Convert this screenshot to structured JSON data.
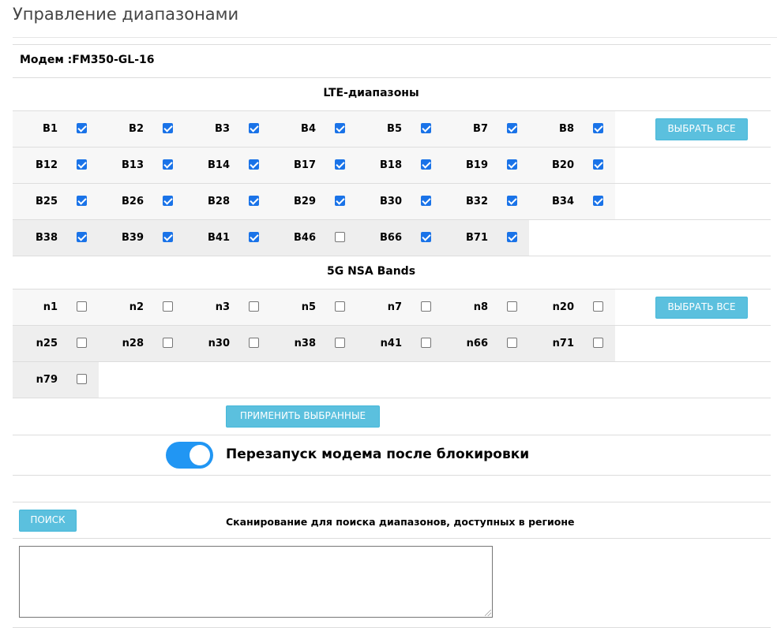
{
  "page": {
    "title": "Управление диапазонами"
  },
  "modem": {
    "label": "Модем :FM350-GL-16"
  },
  "lte": {
    "title": "LTE-диапазоны",
    "select_all_label": "ВЫБРАТЬ ВСЕ",
    "rows": [
      [
        {
          "name": "B1",
          "checked": true
        },
        {
          "name": "B2",
          "checked": true
        },
        {
          "name": "B3",
          "checked": true
        },
        {
          "name": "B4",
          "checked": true
        },
        {
          "name": "B5",
          "checked": true
        },
        {
          "name": "B7",
          "checked": true
        },
        {
          "name": "B8",
          "checked": true
        }
      ],
      [
        {
          "name": "B12",
          "checked": true
        },
        {
          "name": "B13",
          "checked": true
        },
        {
          "name": "B14",
          "checked": true
        },
        {
          "name": "B17",
          "checked": true
        },
        {
          "name": "B18",
          "checked": true
        },
        {
          "name": "B19",
          "checked": true
        },
        {
          "name": "B20",
          "checked": true
        }
      ],
      [
        {
          "name": "B25",
          "checked": true
        },
        {
          "name": "B26",
          "checked": true
        },
        {
          "name": "B28",
          "checked": true
        },
        {
          "name": "B29",
          "checked": true
        },
        {
          "name": "B30",
          "checked": true
        },
        {
          "name": "B32",
          "checked": true
        },
        {
          "name": "B34",
          "checked": true
        }
      ],
      [
        {
          "name": "B38",
          "checked": true
        },
        {
          "name": "B39",
          "checked": true
        },
        {
          "name": "B41",
          "checked": true
        },
        {
          "name": "B46",
          "checked": false
        },
        {
          "name": "B66",
          "checked": true
        },
        {
          "name": "B71",
          "checked": true
        }
      ]
    ]
  },
  "nsa": {
    "title": "5G NSA Bands",
    "select_all_label": "ВЫБРАТЬ ВСЕ",
    "rows": [
      [
        {
          "name": "n1",
          "checked": false
        },
        {
          "name": "n2",
          "checked": false
        },
        {
          "name": "n3",
          "checked": false
        },
        {
          "name": "n5",
          "checked": false
        },
        {
          "name": "n7",
          "checked": false
        },
        {
          "name": "n8",
          "checked": false
        },
        {
          "name": "n20",
          "checked": false
        }
      ],
      [
        {
          "name": "n25",
          "checked": false
        },
        {
          "name": "n28",
          "checked": false
        },
        {
          "name": "n30",
          "checked": false
        },
        {
          "name": "n38",
          "checked": false
        },
        {
          "name": "n41",
          "checked": false
        },
        {
          "name": "n66",
          "checked": false
        },
        {
          "name": "n71",
          "checked": false
        }
      ],
      [
        {
          "name": "n79",
          "checked": false
        }
      ]
    ]
  },
  "apply": {
    "label": "ПРИМЕНИТЬ ВЫБРАННЫЕ"
  },
  "restart_toggle": {
    "label": "Перезапуск модема после блокировки",
    "on": true
  },
  "scan": {
    "button_label": "ПОИСК",
    "description": "Сканирование для поиска диапазонов, доступных в регионе",
    "output_value": ""
  },
  "colors": {
    "button": "#5bc0de",
    "toggle_on": "#2196f3",
    "checkbox_checked": "#1a73e8",
    "row_shade": "#eeeeee",
    "row_light": "#f7f7f7"
  }
}
